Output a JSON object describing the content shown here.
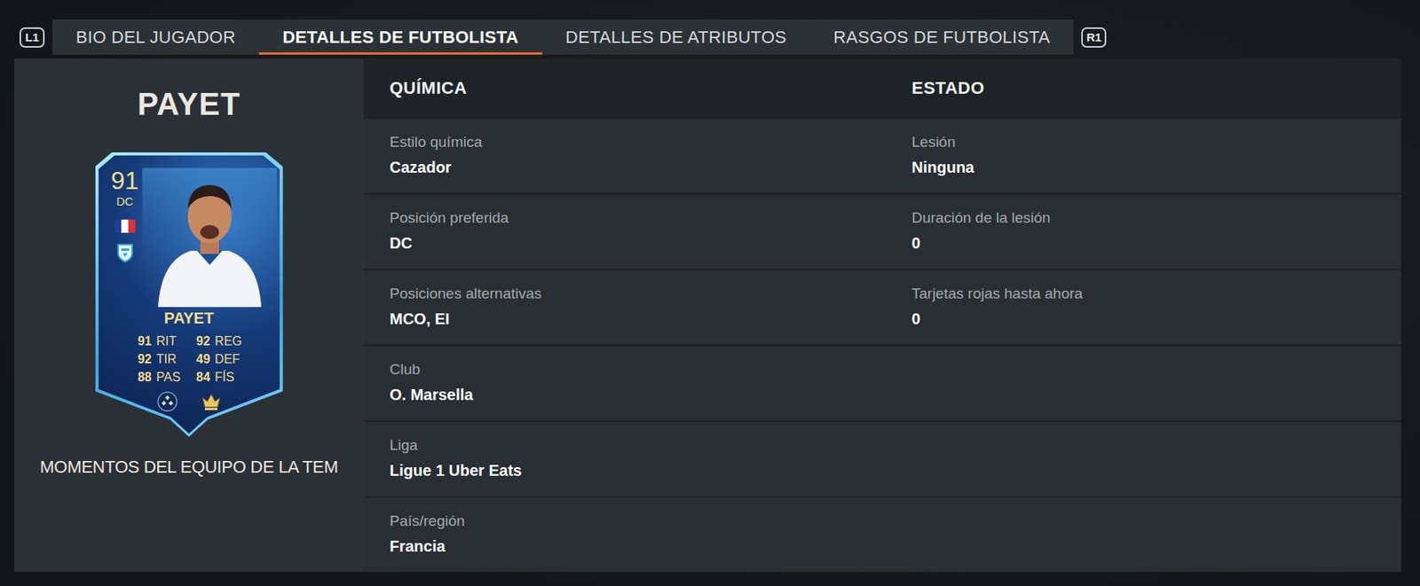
{
  "controls": {
    "prev": "L1",
    "next": "R1"
  },
  "tabs": [
    {
      "label": "BIO DEL JUGADOR",
      "selected": false
    },
    {
      "label": "DETALLES DE FUTBOLISTA",
      "selected": true
    },
    {
      "label": "DETALLES DE ATRIBUTOS",
      "selected": false
    },
    {
      "label": "RASGOS DE FUTBOLISTA",
      "selected": false
    }
  ],
  "player": {
    "title": "PAYET",
    "card_type": "MOMENTOS DEL EQUIPO DE LA TEM",
    "card": {
      "rating": "91",
      "position": "DC",
      "name": "PAYET",
      "stats": [
        {
          "value": "91",
          "label": "RIT"
        },
        {
          "value": "92",
          "label": "TIR"
        },
        {
          "value": "88",
          "label": "PAS"
        },
        {
          "value": "92",
          "label": "REG"
        },
        {
          "value": "49",
          "label": "DEF"
        },
        {
          "value": "84",
          "label": "FÍS"
        }
      ]
    }
  },
  "sections": [
    {
      "title": "QUÍMICA",
      "fields": [
        {
          "label": "Estilo química",
          "value": "Cazador"
        },
        {
          "label": "Posición preferida",
          "value": "DC"
        },
        {
          "label": "Posiciones alternativas",
          "value": "MCO, EI"
        },
        {
          "label": "Club",
          "value": "O. Marsella"
        },
        {
          "label": "Liga",
          "value": "Ligue 1 Uber Eats"
        },
        {
          "label": "País/región",
          "value": "Francia"
        }
      ]
    },
    {
      "title": "ESTADO",
      "fields": [
        {
          "label": "Lesión",
          "value": "Ninguna"
        },
        {
          "label": "Duración de la lesión",
          "value": "0"
        },
        {
          "label": "Tarjetas rojas hasta ahora",
          "value": "0"
        }
      ]
    }
  ]
}
